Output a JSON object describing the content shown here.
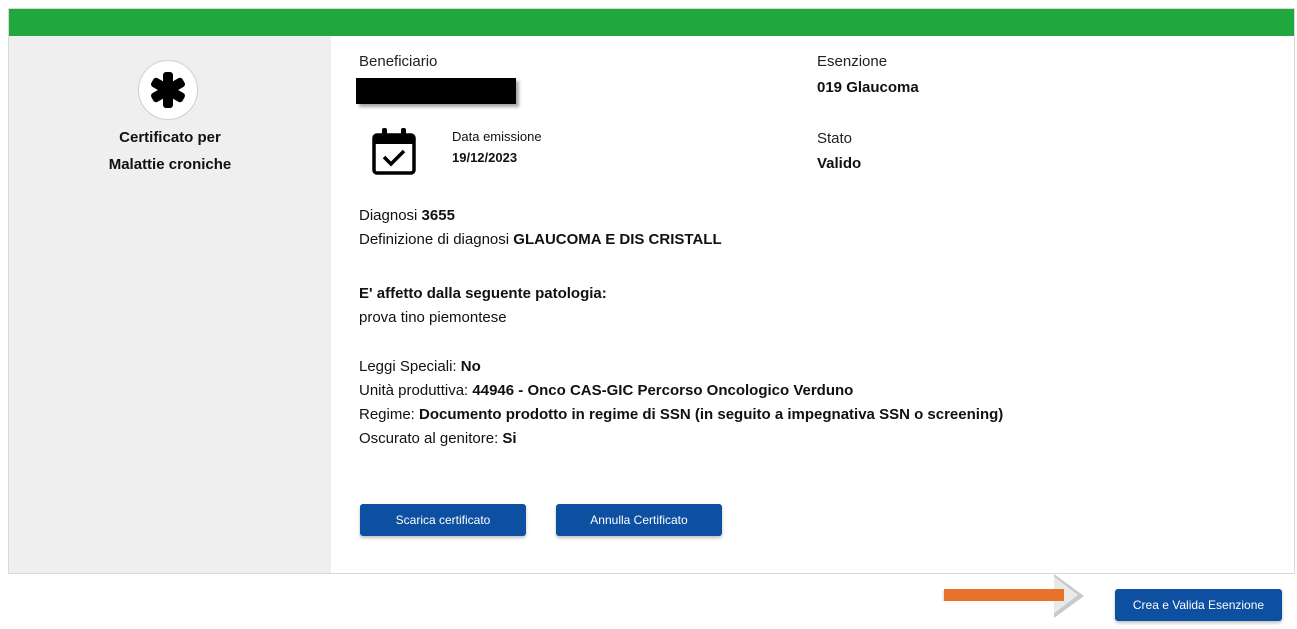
{
  "sidebar": {
    "logo_icon": "asterisk-icon",
    "title_line1": "Certificato per",
    "title_line2": "Malattie croniche"
  },
  "beneficiario": {
    "label": "Beneficiario"
  },
  "esenzione": {
    "label": "Esenzione",
    "value": "019 Glaucoma"
  },
  "data_emissione": {
    "icon": "calendar-check-icon",
    "label": "Data emissione",
    "value": "19/12/2023"
  },
  "stato": {
    "label": "Stato",
    "value": "Valido"
  },
  "diagnosi": {
    "label": "Diagnosi",
    "value": "3655",
    "definizione_label": "Definizione di diagnosi",
    "definizione_value": "GLAUCOMA E DIS CRISTALL"
  },
  "patologia": {
    "heading": "E' affetto dalla seguente patologia:",
    "text": "prova tino piemontese"
  },
  "details": [
    {
      "label": "Leggi Speciali:",
      "value": "No"
    },
    {
      "label": "Unità produttiva:",
      "value": "44946 - Onco CAS-GIC Percorso Oncologico Verduno"
    },
    {
      "label": "Regime:",
      "value": "Documento prodotto in regime di SSN (in seguito a impegnativa SSN o screening)"
    },
    {
      "label": "Oscurato al genitore:",
      "value": "Si"
    }
  ],
  "buttons": {
    "scarica": "Scarica certificato",
    "annulla": "Annulla Certificato",
    "crea": "Crea e Valida Esenzione"
  },
  "colors": {
    "header_green": "#20a83f",
    "button_blue": "#0d4fa0",
    "arrow_orange": "#e8722a"
  }
}
